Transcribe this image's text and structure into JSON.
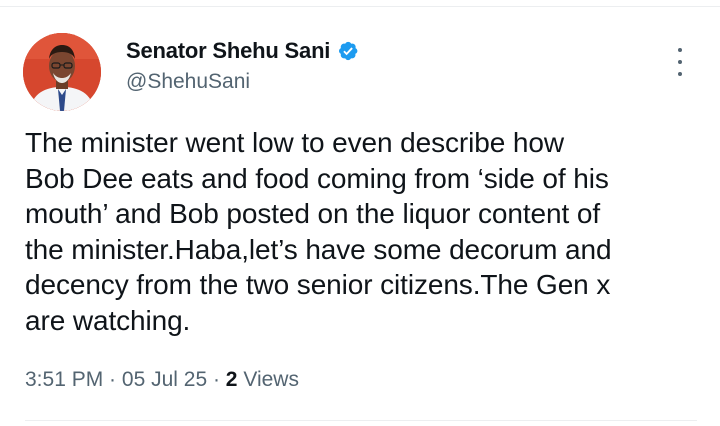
{
  "author": {
    "display_name": "Senator Shehu Sani",
    "handle": "@ShehuSani",
    "verified": true,
    "avatar_icon": "profile-photo-avatar"
  },
  "tweet": {
    "text_lines": [
      "The minister went low to even describe how",
      "Bob Dee eats and food coming from ‘side of his",
      "mouth’ and Bob posted on the liquor content of",
      "the minister.Haba,let’s have some decorum and",
      "decency from the two senior citizens.The Gen x",
      "are watching."
    ]
  },
  "meta": {
    "time": "3:51 PM",
    "separator": " · ",
    "date": "05 Jul 25",
    "views_count": "2",
    "views_label": " Views"
  },
  "icons": {
    "verified": "verified-badge-icon",
    "more": "more-options-icon"
  },
  "colors": {
    "verified_blue": "#1d9bf0",
    "secondary_text": "#536471",
    "primary_text": "#0f1419"
  }
}
